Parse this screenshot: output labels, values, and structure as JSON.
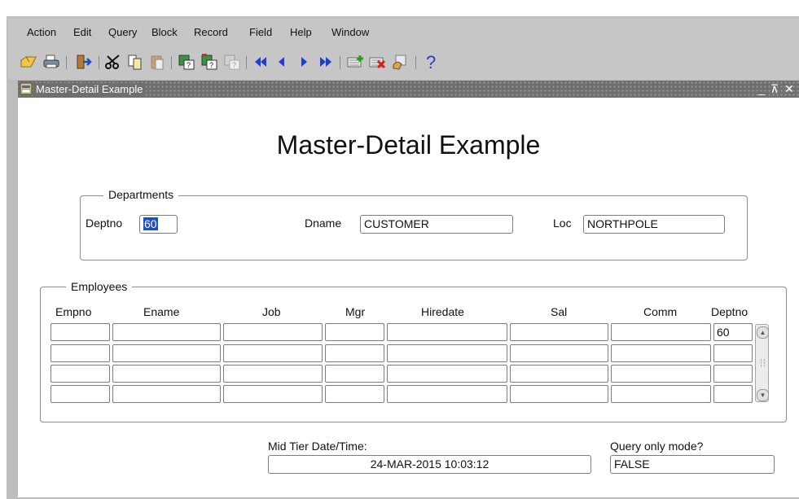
{
  "menu": [
    "Action",
    "Edit",
    "Query",
    "Block",
    "Record",
    "Field",
    "Help",
    "Window"
  ],
  "toolbar_icons": [
    "save-icon",
    "print-icon",
    "exit-icon",
    "cut-icon",
    "copy-icon",
    "paste-icon",
    "enter-query-icon",
    "execute-query-icon",
    "cancel-query-icon",
    "first-record-icon",
    "previous-record-icon",
    "next-record-icon",
    "last-record-icon",
    "insert-record-icon",
    "delete-record-icon",
    "clear-record-icon",
    "help-icon"
  ],
  "window": {
    "title": "Master-Detail Example",
    "controls": [
      "_",
      "⊼",
      "✕"
    ]
  },
  "form": {
    "heading": "Master-Detail Example"
  },
  "departments": {
    "title": "Departments",
    "deptno_label": "Deptno",
    "deptno_value": "60",
    "dname_label": "Dname",
    "dname_value": "CUSTOMER",
    "loc_label": "Loc",
    "loc_value": "NORTHPOLE"
  },
  "employees": {
    "title": "Employees",
    "columns": [
      "Empno",
      "Ename",
      "Job",
      "Mgr",
      "Hiredate",
      "Sal",
      "Comm",
      "Deptno"
    ],
    "rows": [
      [
        "",
        "",
        "",
        "",
        "",
        "",
        "",
        "60"
      ],
      [
        "",
        "",
        "",
        "",
        "",
        "",
        "",
        ""
      ],
      [
        "",
        "",
        "",
        "",
        "",
        "",
        "",
        ""
      ],
      [
        "",
        "",
        "",
        "",
        "",
        "",
        "",
        ""
      ]
    ]
  },
  "footer": {
    "datetime_label": "Mid Tier Date/Time:",
    "datetime_value": "24-MAR-2015 10:03:12",
    "query_label": "Query only mode?",
    "query_value": "FALSE"
  },
  "colors": {
    "title_bar": "#6f6f6f",
    "selection": "#1c4fc8",
    "chrome": "#c6c6c6"
  }
}
